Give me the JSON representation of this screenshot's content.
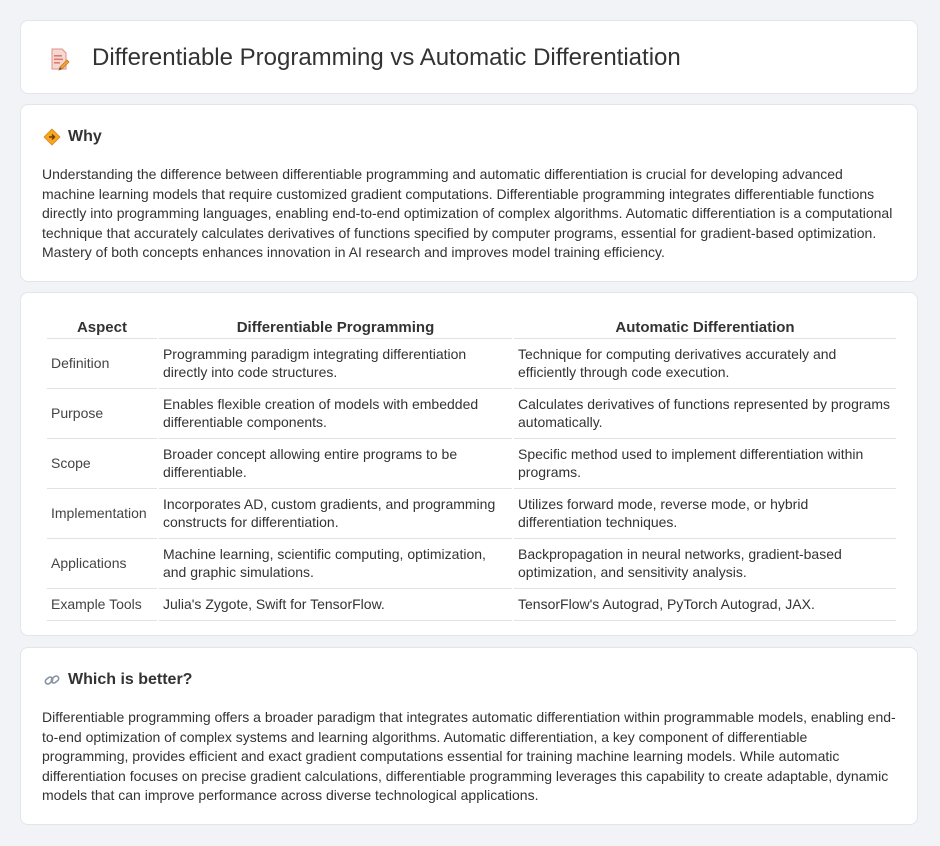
{
  "header": {
    "title": "Differentiable Programming vs Automatic Differentiation",
    "icon": "document-pencil-icon"
  },
  "why": {
    "heading": "Why",
    "icon": "diamond-warning-icon",
    "text": "Understanding the difference between differentiable programming and automatic differentiation is crucial for developing advanced machine learning models that require customized gradient computations. Differentiable programming integrates differentiable functions directly into programming languages, enabling end-to-end optimization of complex algorithms. Automatic differentiation is a computational technique that accurately calculates derivatives of functions specified by computer programs, essential for gradient-based optimization. Mastery of both concepts enhances innovation in AI research and improves model training efficiency."
  },
  "table": {
    "headers": [
      "Aspect",
      "Differentiable Programming",
      "Automatic Differentiation"
    ],
    "rows": [
      [
        "Definition",
        "Programming paradigm integrating differentiation directly into code structures.",
        "Technique for computing derivatives accurately and efficiently through code execution."
      ],
      [
        "Purpose",
        "Enables flexible creation of models with embedded differentiable components.",
        "Calculates derivatives of functions represented by programs automatically."
      ],
      [
        "Scope",
        "Broader concept allowing entire programs to be differentiable.",
        "Specific method used to implement differentiation within programs."
      ],
      [
        "Implementation",
        "Incorporates AD, custom gradients, and programming constructs for differentiation.",
        "Utilizes forward mode, reverse mode, or hybrid differentiation techniques."
      ],
      [
        "Applications",
        "Machine learning, scientific computing, optimization, and graphic simulations.",
        "Backpropagation in neural networks, gradient-based optimization, and sensitivity analysis."
      ],
      [
        "Example Tools",
        "Julia's Zygote, Swift for TensorFlow.",
        "TensorFlow's Autograd, PyTorch Autograd, JAX."
      ]
    ]
  },
  "better": {
    "heading": "Which is better?",
    "icon": "link-icon",
    "text": "Differentiable programming offers a broader paradigm that integrates automatic differentiation within programmable models, enabling end-to-end optimization of complex systems and learning algorithms. Automatic differentiation, a key component of differentiable programming, provides efficient and exact gradient computations essential for training machine learning models. While automatic differentiation focuses on precise gradient calculations, differentiable programming leverages this capability to create adaptable, dynamic models that can improve performance across diverse technological applications."
  }
}
